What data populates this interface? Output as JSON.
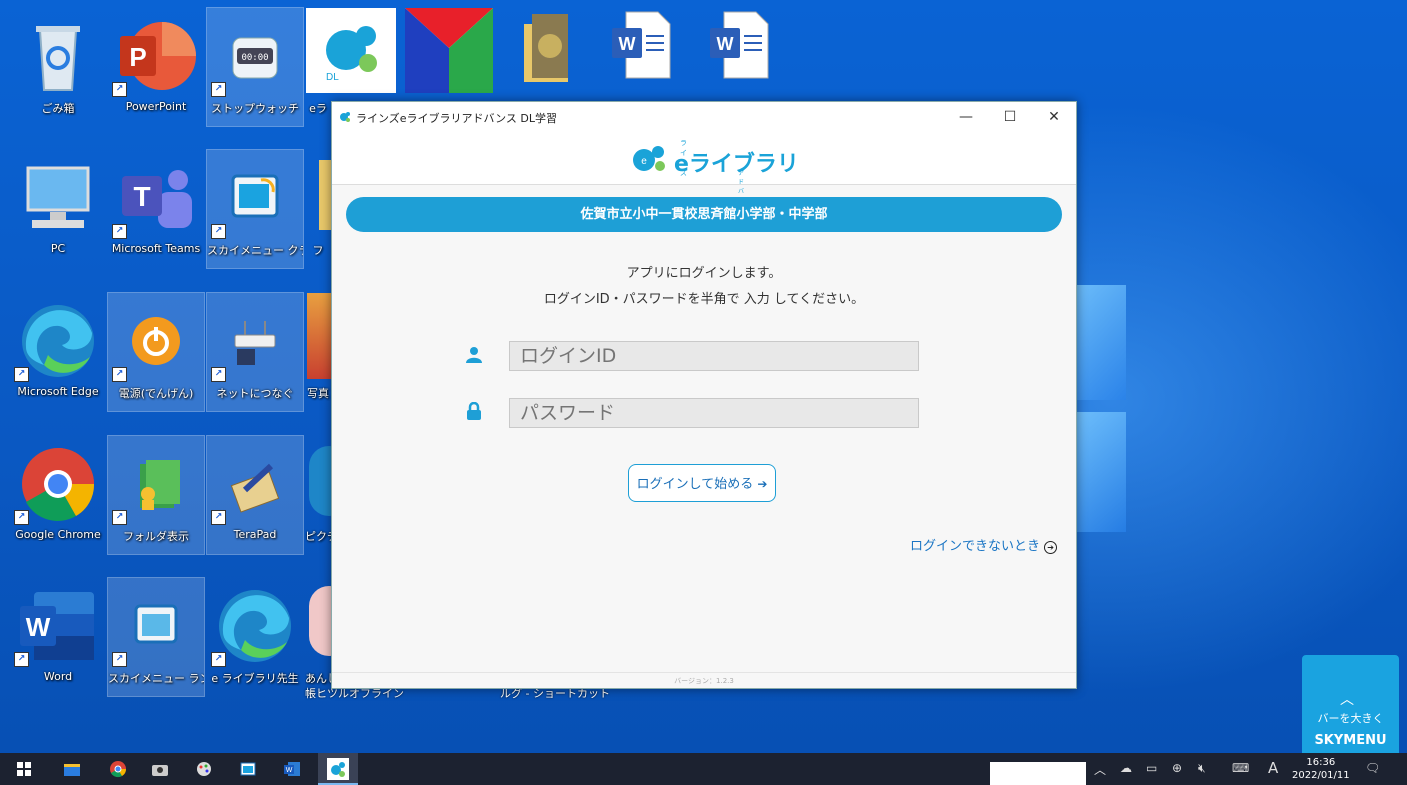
{
  "desktop": {
    "icons": [
      {
        "label": "ごみ箱"
      },
      {
        "label": "PowerPoint"
      },
      {
        "label": "ストップウォッチ"
      },
      {
        "label": "eラ"
      },
      {
        "label": "PC"
      },
      {
        "label": "Microsoft Teams"
      },
      {
        "label": "スカイメニュー クラス"
      },
      {
        "label": "フ"
      },
      {
        "label": "Microsoft Edge"
      },
      {
        "label": "電源(でんげん)"
      },
      {
        "label": "ネットにつなぐ"
      },
      {
        "label": "写真"
      },
      {
        "label": "Google Chrome"
      },
      {
        "label": "フォルダ表示"
      },
      {
        "label": "TeraPad"
      },
      {
        "label": "ピクチ"
      },
      {
        "label": "Word"
      },
      {
        "label": "スカイメニュー ランチャー"
      },
      {
        "label": "e ライブラリ先生"
      },
      {
        "label": "あんし"
      },
      {
        "label": "帳ヒツルオフライン"
      },
      {
        "label": "ルグ - ショートカット"
      }
    ]
  },
  "window": {
    "title": "ラインズeライブラリアドバンス DL学習",
    "minimize": "—",
    "maximize": "☐",
    "close": "✕",
    "brand_ruby": "ラインズ",
    "brand_name": "eライブラリ",
    "brand_sub": "アドバンス",
    "school": "佐賀市立小中一貫校思斉館小学部・中学部",
    "instruction1": "アプリにログインします。",
    "instruction2": "ログインID・パスワードを半角で 入力 してください。",
    "id_placeholder": "ログインID",
    "password_placeholder": "パスワード",
    "login_button": "ログインして始める",
    "forgot_link": "ログインできないとき",
    "version": "バージョン：1.2.3"
  },
  "skymenu": {
    "line1": "バーを大きく",
    "line2": "SKYMENU"
  },
  "taskbar": {
    "ime": "A",
    "time": "16:36",
    "date": "2022/01/11"
  },
  "colors": {
    "accent": "#1e9fd6",
    "desktop": "#0a5cc8",
    "taskbar": "#1c2230"
  }
}
